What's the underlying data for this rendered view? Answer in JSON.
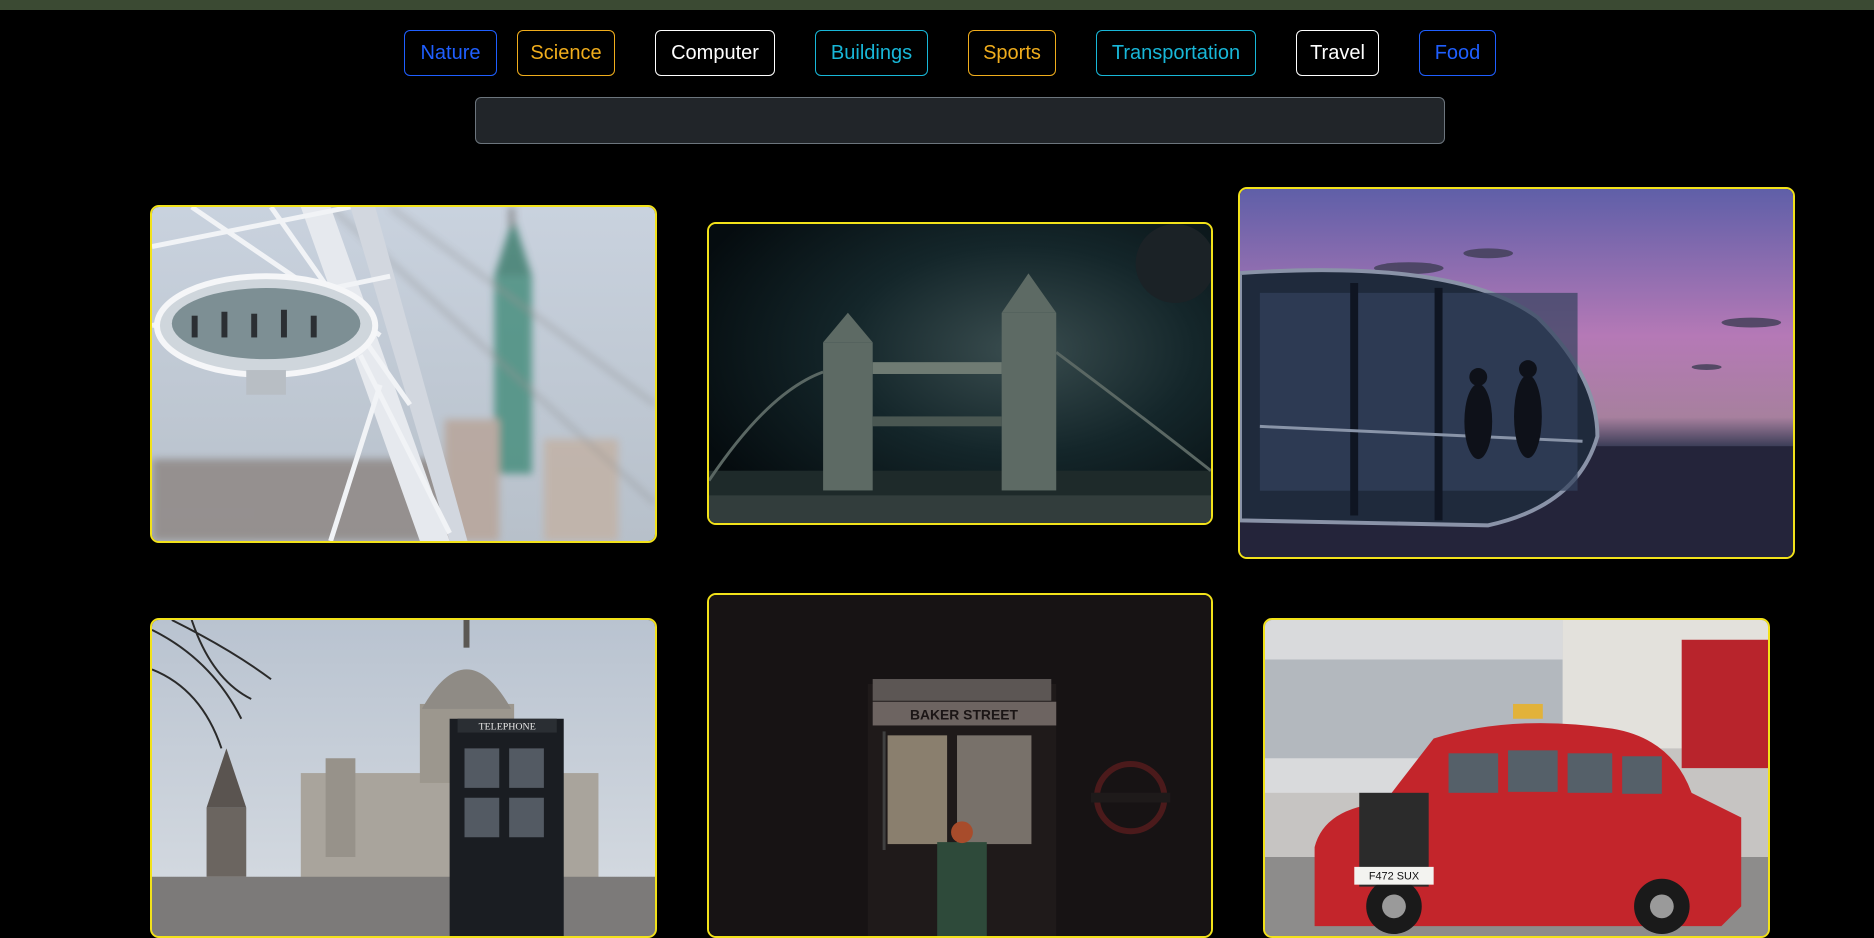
{
  "categories": [
    {
      "label": "Nature",
      "color": "#1f5fff"
    },
    {
      "label": "Science",
      "color": "#f0ad1c"
    },
    {
      "label": "Computer",
      "color": "#ffffff"
    },
    {
      "label": "Buildings",
      "color": "#18b7d8"
    },
    {
      "label": "Sports",
      "color": "#f0ad1c"
    },
    {
      "label": "Transportation",
      "color": "#18b7d8"
    },
    {
      "label": "Travel",
      "color": "#ffffff"
    },
    {
      "label": "Food",
      "color": "#1f5fff"
    }
  ],
  "search": {
    "value": "",
    "placeholder": ""
  },
  "gallery": {
    "border_color": "#f2e21a",
    "photos": [
      {
        "subject": "London Eye capsule with blurred church tower",
        "sign_text": ""
      },
      {
        "subject": "Tower Bridge at night with moon",
        "sign_text": ""
      },
      {
        "subject": "London Eye pod at sunset over city",
        "sign_text": ""
      },
      {
        "subject": "St Paul's Cathedral with red telephone box",
        "sign_text": "TELEPHONE"
      },
      {
        "subject": "Baker Street underground station",
        "sign_text": "BAKER STREET"
      },
      {
        "subject": "Red London taxi cab",
        "sign_text": "F472 SUX"
      }
    ]
  }
}
